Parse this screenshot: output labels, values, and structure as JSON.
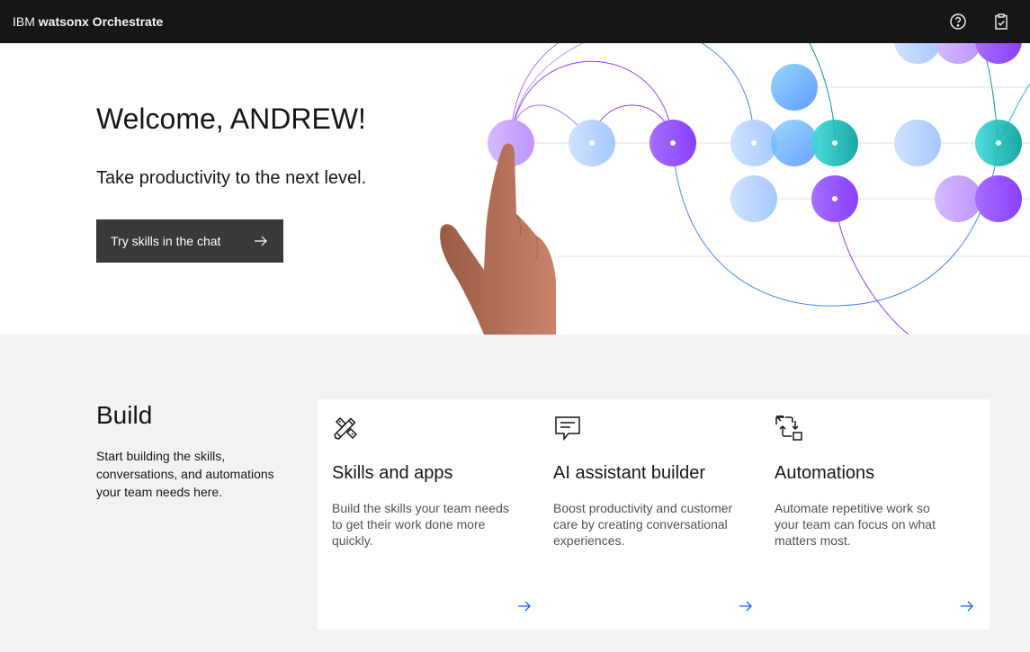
{
  "header": {
    "brand_prefix": "IBM",
    "brand_name": "watsonx Orchestrate",
    "icons": [
      "help-icon",
      "clipboard-icon"
    ]
  },
  "hero": {
    "title": "Welcome, ANDREW!",
    "subtitle": "Take productivity to the next level.",
    "cta_label": "Try skills in the chat"
  },
  "build": {
    "title": "Build",
    "description": "Start building the skills, conversations, and automations your team needs here.",
    "cards": [
      {
        "icon": "tools-icon",
        "title": "Skills and apps",
        "description": "Build the skills your team needs to get their work done more quickly."
      },
      {
        "icon": "chat-icon",
        "title": "AI assistant builder",
        "description": "Boost productivity and customer care by creating conversational experiences."
      },
      {
        "icon": "automation-icon",
        "title": "Automations",
        "description": "Automate repetitive work so your team can focus on what matters most."
      }
    ]
  },
  "colors": {
    "header_bg": "#161616",
    "button_bg": "#393939",
    "link_blue": "#0f62fe",
    "purple": "#8a3ffc",
    "teal": "#009d9a"
  }
}
